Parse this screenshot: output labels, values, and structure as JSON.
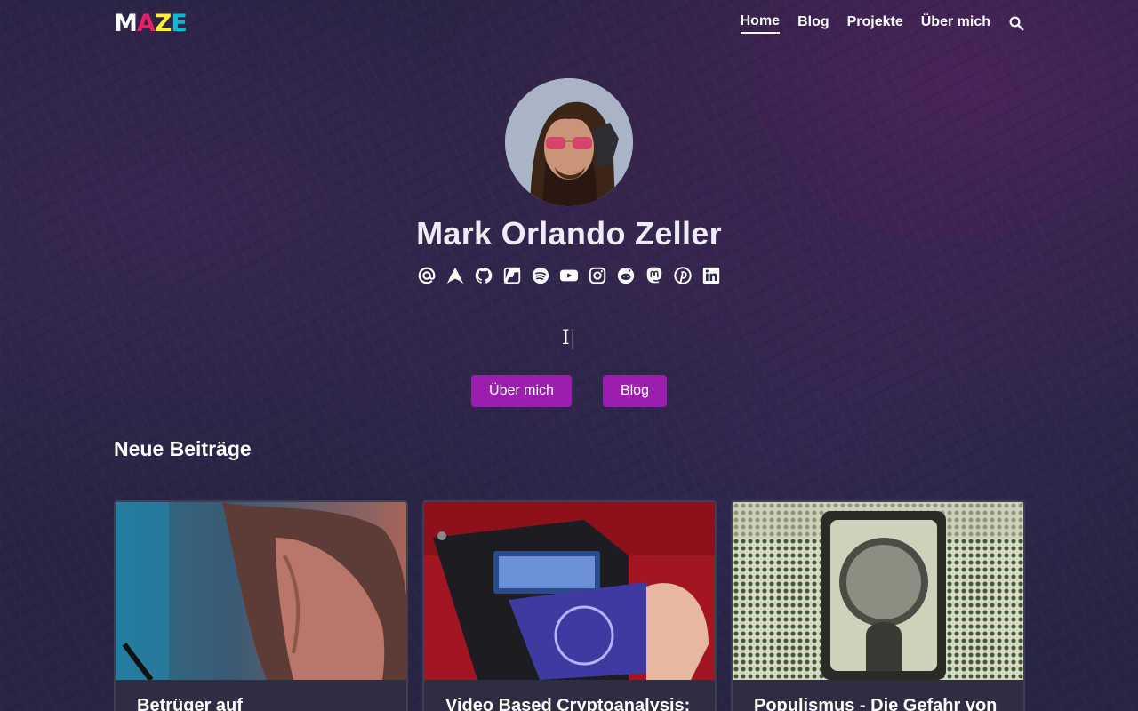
{
  "header": {
    "logo_letters": [
      "M",
      "A",
      "Z",
      "E"
    ],
    "logo_colors": [
      "#ffffff",
      "#e91e63",
      "#ffeb3b",
      "#00bcd4"
    ],
    "nav": [
      {
        "label": "Home",
        "active": true
      },
      {
        "label": "Blog",
        "active": false
      },
      {
        "label": "Projekte",
        "active": false
      },
      {
        "label": "Über mich",
        "active": false
      }
    ],
    "search_icon": "search-icon"
  },
  "hero": {
    "name": "Mark Orlando Zeller",
    "socials": [
      "email",
      "arch",
      "github",
      "flipboard",
      "spotify",
      "youtube",
      "instagram",
      "reddit",
      "mastodon",
      "pinterest",
      "linkedin"
    ],
    "typing_text": "I",
    "buttons": {
      "about": "Über mich",
      "blog": "Blog"
    },
    "accent": "#9b1fae"
  },
  "posts_section": {
    "title": "Neue Beiträge",
    "posts": [
      {
        "title": "Betrüger auf"
      },
      {
        "title": "Video Based Cryptoanalysis:"
      },
      {
        "title": "Populismus - Die Gefahr von"
      }
    ]
  }
}
